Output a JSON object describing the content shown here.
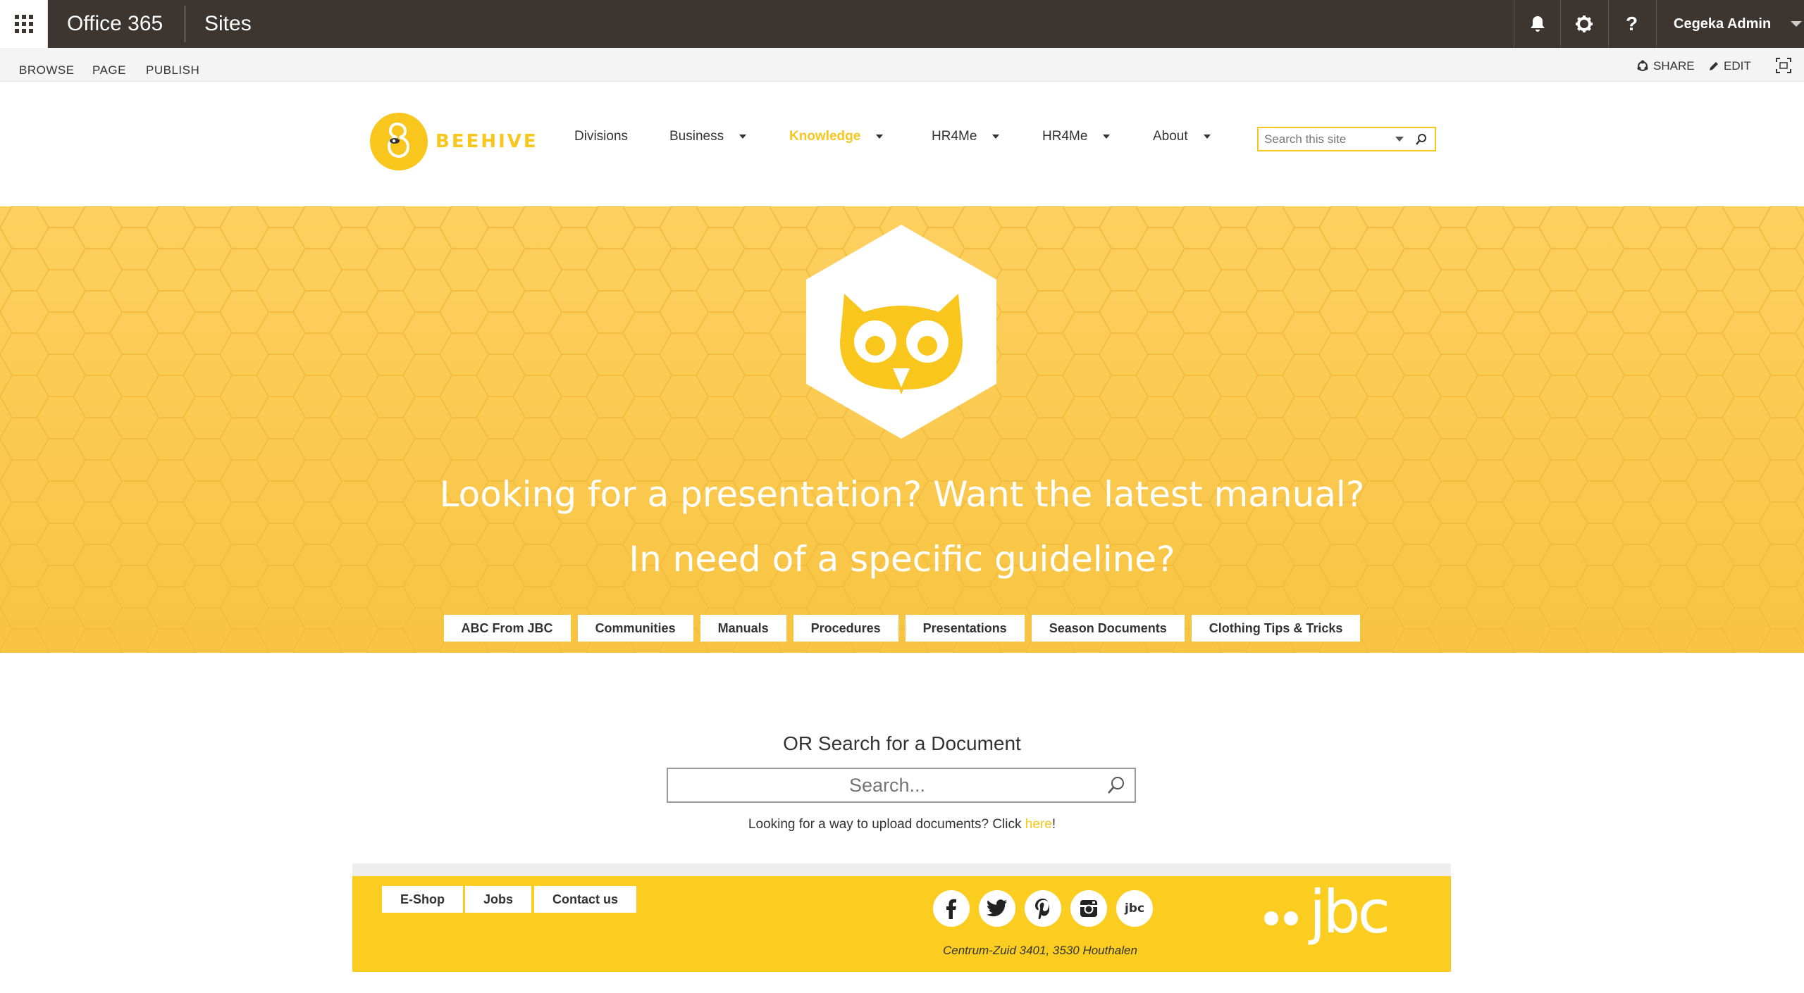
{
  "suitebar": {
    "app_title": "Office 365",
    "section": "Sites",
    "user": "Cegeka Admin",
    "icons": [
      "app-launcher-icon",
      "bell-icon",
      "gear-icon",
      "help-icon"
    ]
  },
  "ribbon": {
    "tabs": [
      "BROWSE",
      "PAGE",
      "PUBLISH"
    ],
    "share": "SHARE",
    "edit": "EDIT",
    "icons": [
      "share-icon",
      "edit-icon",
      "focus-icon"
    ]
  },
  "header": {
    "logo_text": "BEEHIVE",
    "nav": [
      {
        "label": "Divisions",
        "dropdown": false
      },
      {
        "label": "Business",
        "dropdown": true
      },
      {
        "label": "Knowledge",
        "dropdown": true,
        "active": true
      },
      {
        "label": "HR4Me",
        "dropdown": true
      },
      {
        "label": "HR4Me",
        "dropdown": true
      },
      {
        "label": "About",
        "dropdown": true
      }
    ],
    "search_placeholder": "Search this site"
  },
  "hero": {
    "line1": "Looking for a presentation? Want the latest manual?",
    "line2": "In need of a specific guideline?",
    "categories": [
      "ABC From JBC",
      "Communities",
      "Manuals",
      "Procedures",
      "Presentations",
      "Season Documents",
      "Clothing Tips & Tricks"
    ],
    "icon": "owl-icon"
  },
  "document_search": {
    "title": "OR Search for a Document",
    "placeholder": "Search...",
    "upload_text": "Looking for a way to upload documents? Click ",
    "upload_link": "here",
    "upload_suffix": "!"
  },
  "footer": {
    "buttons": [
      "E-Shop",
      "Jobs",
      "Contact us"
    ],
    "socials": [
      "facebook-icon",
      "twitter-icon",
      "pinterest-icon",
      "instagram-icon",
      "jbc-app-icon"
    ],
    "jbc_social_label": "jbc",
    "address": "Centrum-Zuid 3401, 3530 Houthalen",
    "brand": "jbc"
  },
  "colors": {
    "suitebar": "#3c3530",
    "accent": "#f8c61c",
    "hero": "#fbc94f",
    "footer": "#fccd21"
  }
}
